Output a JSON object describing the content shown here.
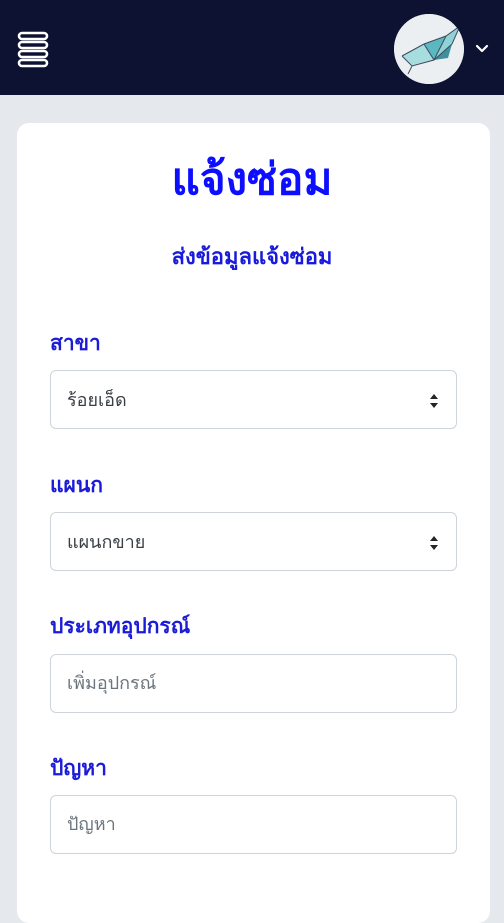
{
  "header": {
    "menu_icon": "hamburger-menu-icon",
    "avatar_icon": "origami-bird-logo",
    "dropdown_icon": "chevron-down-icon"
  },
  "colors": {
    "navbar": "#0d1232",
    "accent": "#0d0dff",
    "page_background": "#e5e8ec"
  },
  "form": {
    "title": "แจ้งซ่อม",
    "subtitle": "ส่งข้อมูลแจ้งซ่อม",
    "branch": {
      "label": "สาขา",
      "value": "ร้อยเอ็ด"
    },
    "department": {
      "label": "แผนก",
      "value": "แผนกขาย"
    },
    "device_type": {
      "label": "ประเภทอุปกรณ์",
      "placeholder": "เพิ่มอุปกรณ์"
    },
    "problem": {
      "label": "ปัญหา",
      "placeholder": "ปัญหา"
    }
  }
}
